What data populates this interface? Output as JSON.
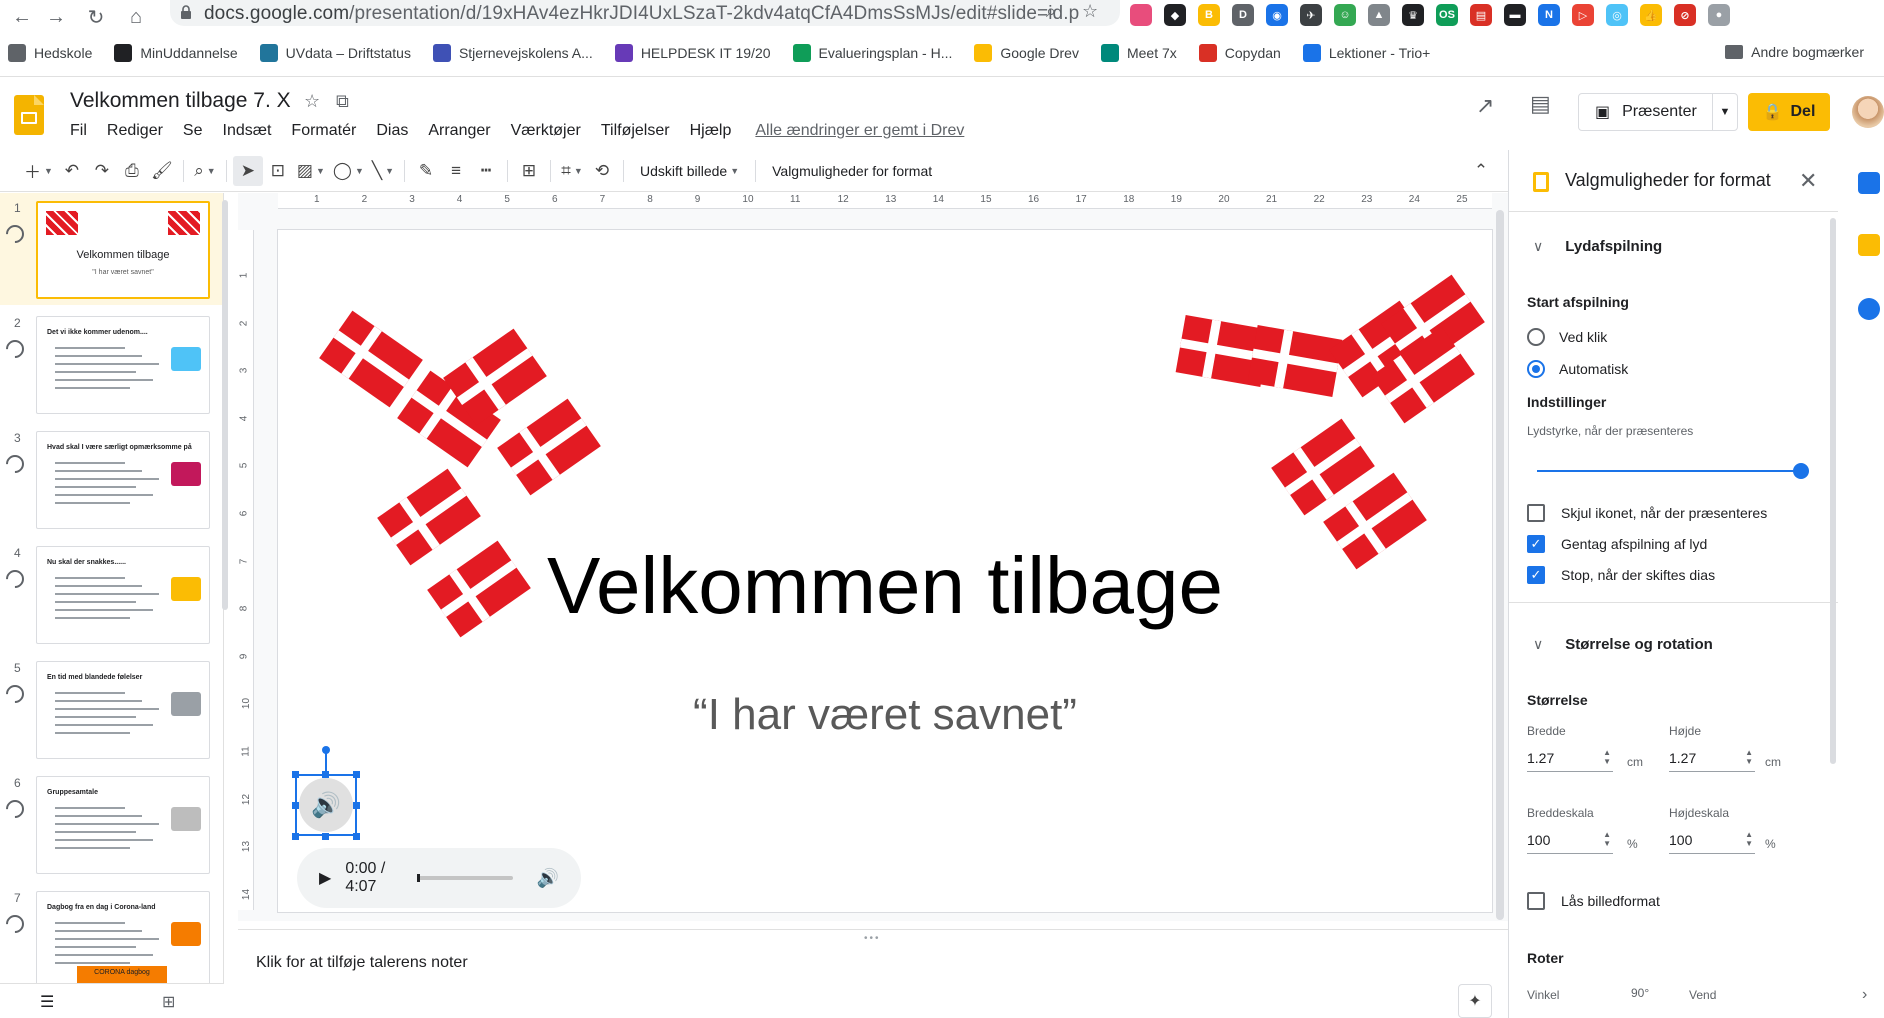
{
  "browser": {
    "url_host": "docs.google.com",
    "url_path": "/presentation/d/19xHAv4ezHkrJDI4UxLSzaT-2kdv4atqCfA4DmsSsMJs/edit#slide=id.p",
    "extensions": [
      {
        "name": "ext-1",
        "color": "#e84d7c",
        "label": ""
      },
      {
        "name": "ext-2",
        "color": "#202124",
        "label": "◆"
      },
      {
        "name": "ext-3",
        "color": "#fbbc04",
        "label": "B"
      },
      {
        "name": "ext-4",
        "color": "#5f6368",
        "label": "D"
      },
      {
        "name": "ext-5",
        "color": "#1a73e8",
        "label": "◉"
      },
      {
        "name": "ext-6",
        "color": "#3c4043",
        "label": "✈"
      },
      {
        "name": "ext-7",
        "color": "#34a853",
        "label": "☺"
      },
      {
        "name": "ext-8",
        "color": "#80868b",
        "label": "▲"
      },
      {
        "name": "ext-9",
        "color": "#202124",
        "label": "♛"
      },
      {
        "name": "ext-10",
        "color": "#0f9d58",
        "label": "OS"
      },
      {
        "name": "ext-11",
        "color": "#d93025",
        "label": "▤"
      },
      {
        "name": "ext-12",
        "color": "#202124",
        "label": "▬"
      },
      {
        "name": "ext-13",
        "color": "#1a73e8",
        "label": "N"
      },
      {
        "name": "ext-14",
        "color": "#ea4335",
        "label": "▷"
      },
      {
        "name": "ext-15",
        "color": "#4fc3f7",
        "label": "◎"
      },
      {
        "name": "ext-16",
        "color": "#fbbc04",
        "label": "👍"
      },
      {
        "name": "ext-17",
        "color": "#d93025",
        "label": "⊘"
      },
      {
        "name": "ext-18",
        "color": "#9aa0a6",
        "label": "●"
      }
    ]
  },
  "bookmarks": {
    "items": [
      {
        "label": "Hedskole",
        "color": "#5f6368"
      },
      {
        "label": "MinUddannelse",
        "color": "#202124"
      },
      {
        "label": "UVdata – Driftstatus",
        "color": "#21759b"
      },
      {
        "label": "Stjernevejskolens A...",
        "color": "#3f51b5"
      },
      {
        "label": "HELPDESK IT 19/20",
        "color": "#673ab7"
      },
      {
        "label": "Evalueringsplan - H...",
        "color": "#0f9d58"
      },
      {
        "label": "Google Drev",
        "color": "#fbbc04"
      },
      {
        "label": "Meet 7x",
        "color": "#00897b"
      },
      {
        "label": "Copydan",
        "color": "#d93025"
      },
      {
        "label": "Lektioner - Trio+",
        "color": "#1a73e8"
      }
    ],
    "other": "Andre bogmærker"
  },
  "doc": {
    "title": "Velkommen tilbage 7. X",
    "menu": [
      "Fil",
      "Rediger",
      "Se",
      "Indsæt",
      "Formatér",
      "Dias",
      "Arranger",
      "Værktøjer",
      "Tilføjelser",
      "Hjælp"
    ],
    "save_status": "Alle ændringer er gemt i Drev",
    "present_label": "Præsenter",
    "share_label": "Del"
  },
  "toolbar": {
    "replace_image": "Udskift billede",
    "format_options": "Valgmuligheder for format"
  },
  "filmstrip": {
    "slides": [
      {
        "num": "1",
        "title": "Velkommen tilbage",
        "subtitle": "\"I har været savnet\""
      },
      {
        "num": "2",
        "title": "Det vi ikke kommer udenom...."
      },
      {
        "num": "3",
        "title": "Hvad skal I være særligt opmærksomme på"
      },
      {
        "num": "4",
        "title": "Nu skal der snakkes......"
      },
      {
        "num": "5",
        "title": "En tid med blandede følelser"
      },
      {
        "num": "6",
        "title": "Gruppesamtale"
      },
      {
        "num": "7",
        "title": "Dagbog fra en dag i Corona-land",
        "badge": "CORONA dagbog"
      }
    ]
  },
  "ruler": {
    "top": [
      "1",
      "2",
      "3",
      "4",
      "5",
      "6",
      "7",
      "8",
      "9",
      "10",
      "11",
      "12",
      "13",
      "14",
      "15",
      "16",
      "17",
      "18",
      "19",
      "20",
      "21",
      "22",
      "23",
      "24",
      "25"
    ],
    "left": [
      "1",
      "2",
      "3",
      "4",
      "5",
      "6",
      "7",
      "8",
      "9",
      "10",
      "11",
      "12",
      "13",
      "14"
    ]
  },
  "slide": {
    "title": "Velkommen tilbage",
    "subtitle": "“I har været savnet”",
    "audio": {
      "time": "0:00 / 4:07",
      "progress": 0.0
    }
  },
  "notes": {
    "placeholder": "Klik for at tilføje talerens noter"
  },
  "panel": {
    "title": "Valgmuligheder for format",
    "audio_section": "Lydafspilning",
    "start_label": "Start afspilning",
    "start_options": [
      {
        "label": "Ved klik",
        "selected": false
      },
      {
        "label": "Automatisk",
        "selected": true
      }
    ],
    "settings_label": "Indstillinger",
    "volume_label": "Lydstyrke, når der præsenteres",
    "volume_level": 1.0,
    "checkboxes": [
      {
        "label": "Skjul ikonet, når der præsenteres",
        "checked": false
      },
      {
        "label": "Gentag afspilning af lyd",
        "checked": true
      },
      {
        "label": "Stop, når der skiftes dias",
        "checked": true
      }
    ],
    "size_section": "Størrelse og rotation",
    "size_label": "Størrelse",
    "width_label": "Bredde",
    "width_value": "1.27",
    "height_label": "Højde",
    "height_value": "1.27",
    "unit_cm": "cm",
    "width_scale_label": "Breddeskala",
    "width_scale_value": "100",
    "height_scale_label": "Højdeskala",
    "height_scale_value": "100",
    "unit_pct": "%",
    "lock_ratio_label": "Lås billedformat",
    "lock_ratio_checked": false,
    "rotate_label": "Roter",
    "angle_label": "Vinkel",
    "rotate_90": "90°",
    "flip_label": "Vend"
  }
}
